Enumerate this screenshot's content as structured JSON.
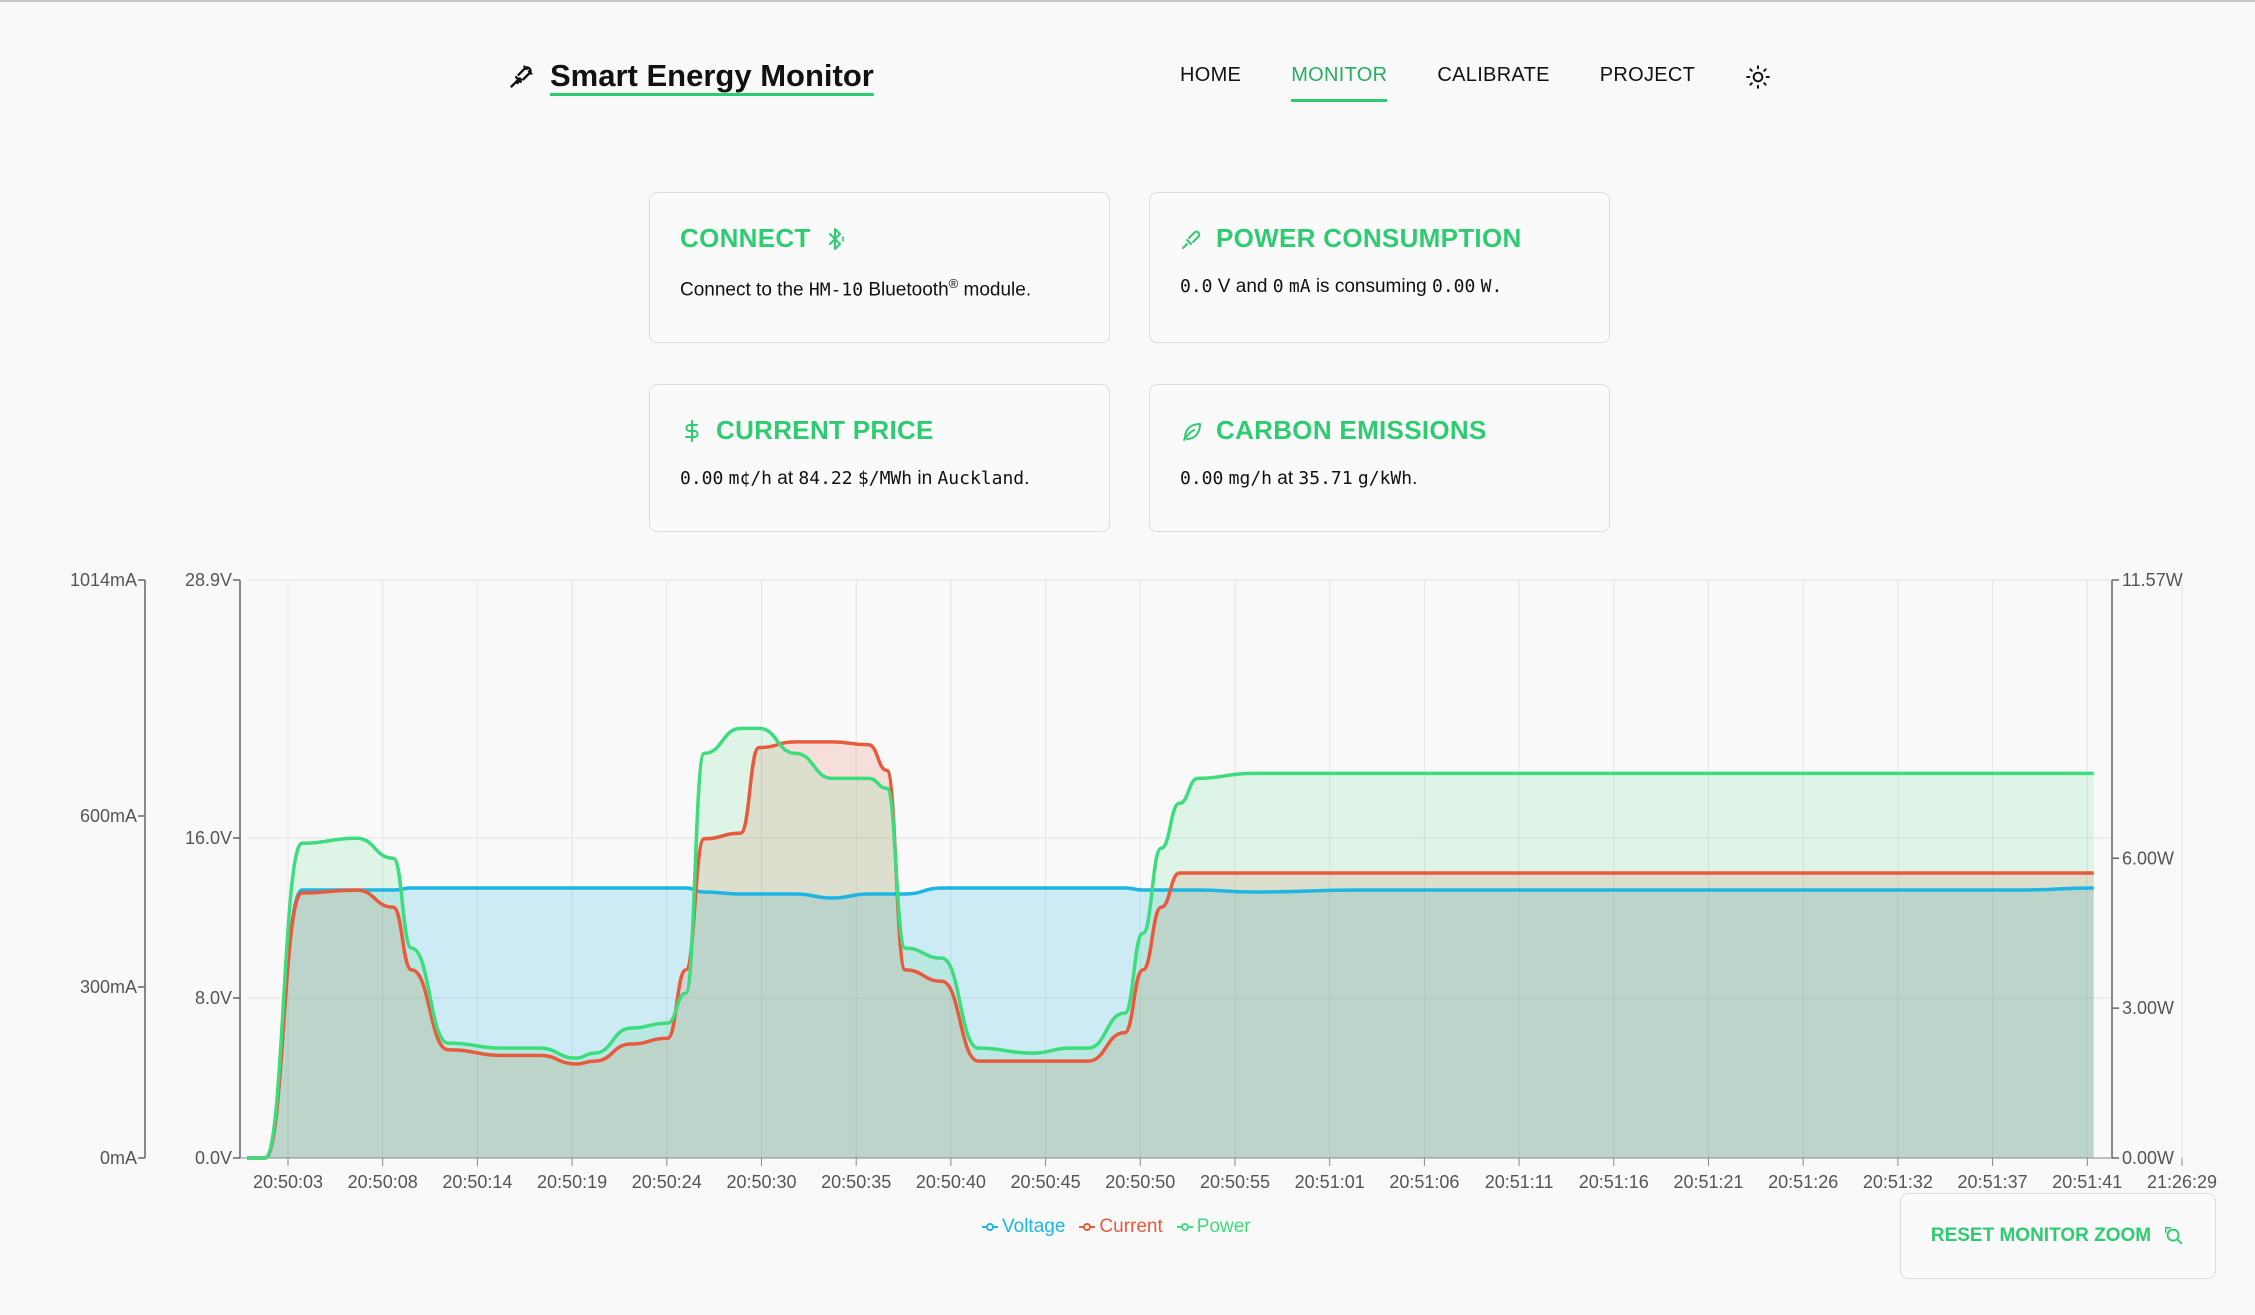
{
  "header": {
    "title": "Smart Energy Monitor",
    "logo_icon": "plug-icon",
    "nav": [
      {
        "label": "HOME",
        "active": false
      },
      {
        "label": "MONITOR",
        "active": true
      },
      {
        "label": "CALIBRATE",
        "active": false
      },
      {
        "label": "PROJECT",
        "active": false
      }
    ],
    "theme_icon": "sun-icon"
  },
  "cards": {
    "connect": {
      "title": "CONNECT",
      "icon": "bluetooth-icon",
      "text_pre": "Connect to the",
      "module": "HM-10",
      "text_mid": "Bluetooth",
      "registered": "®",
      "text_post": "module."
    },
    "power": {
      "title": "POWER CONSUMPTION",
      "icon": "plug-icon",
      "voltage": "0.0",
      "voltage_unit": "V and",
      "current": "0",
      "current_unit": "mA",
      "text_mid": "is consuming",
      "power": "0.00",
      "power_unit": "W."
    },
    "price": {
      "title": "CURRENT PRICE",
      "icon": "dollar-icon",
      "cost": "0.00",
      "cost_unit": "m¢/h",
      "text_at": "at",
      "rate": "84.22",
      "rate_unit": "$/MWh",
      "text_in": "in",
      "region": "Auckland",
      "text_end": "."
    },
    "carbon": {
      "title": "CARBON EMISSIONS",
      "icon": "leaf-icon",
      "emission": "0.00",
      "emission_unit": "mg/h",
      "text_at": "at",
      "intensity": "35.71",
      "intensity_unit": "g/kWh",
      "text_end": "."
    }
  },
  "reset_button": {
    "label": "RESET MONITOR ZOOM",
    "icon": "zoom-reset-icon"
  },
  "colors": {
    "accent": "#2ecc71",
    "voltage": "#1fb5e3",
    "current": "#e85a3c",
    "power": "#3ddc7c"
  },
  "chart_data": {
    "type": "area",
    "x": [
      "20:50:00",
      "20:50:01",
      "20:50:03",
      "20:50:06",
      "20:50:08",
      "20:50:09",
      "20:50:11",
      "20:50:14",
      "20:50:16",
      "20:50:18",
      "20:50:19",
      "20:50:21",
      "20:50:23",
      "20:50:24",
      "20:50:25",
      "20:50:27",
      "20:50:28",
      "20:50:30",
      "20:50:32",
      "20:50:34",
      "20:50:35",
      "20:50:36",
      "20:50:38",
      "20:50:40",
      "20:50:43",
      "20:50:45",
      "20:50:46",
      "20:50:48",
      "20:50:49",
      "20:50:50",
      "20:50:51",
      "20:50:52",
      "20:50:55",
      "20:51:01",
      "20:51:06",
      "20:51:11",
      "20:51:16",
      "20:51:21",
      "20:51:26",
      "20:51:32",
      "20:51:37",
      "20:51:41"
    ],
    "x_tick_labels": [
      "20:50:03",
      "20:50:08",
      "20:50:14",
      "20:50:19",
      "20:50:24",
      "20:50:30",
      "20:50:35",
      "20:50:40",
      "20:50:45",
      "20:50:50",
      "20:50:55",
      "20:51:01",
      "20:51:06",
      "20:51:11",
      "20:51:16",
      "20:51:21",
      "20:51:26",
      "20:51:32",
      "20:51:37",
      "20:51:41",
      "21:26:29"
    ],
    "series": [
      {
        "name": "Voltage",
        "axis": "voltage",
        "values": [
          0,
          0,
          13.4,
          13.4,
          13.4,
          13.5,
          13.5,
          13.5,
          13.5,
          13.5,
          13.5,
          13.5,
          13.5,
          13.5,
          13.3,
          13.2,
          13.2,
          13.2,
          13.0,
          13.2,
          13.2,
          13.2,
          13.5,
          13.5,
          13.5,
          13.5,
          13.5,
          13.5,
          13.4,
          13.4,
          13.4,
          13.4,
          13.3,
          13.4,
          13.4,
          13.4,
          13.4,
          13.4,
          13.4,
          13.4,
          13.4,
          13.5
        ]
      },
      {
        "name": "Current",
        "axis": "current",
        "values": [
          0,
          0,
          465,
          470,
          440,
          330,
          190,
          180,
          180,
          165,
          170,
          200,
          210,
          330,
          560,
          570,
          720,
          730,
          730,
          725,
          680,
          330,
          310,
          170,
          170,
          170,
          170,
          220,
          330,
          440,
          500,
          500,
          500,
          500,
          500,
          500,
          500,
          500,
          500,
          500,
          500,
          500
        ]
      },
      {
        "name": "Power",
        "axis": "power",
        "values": [
          0,
          0,
          6.3,
          6.4,
          6.0,
          4.2,
          2.3,
          2.2,
          2.2,
          2.0,
          2.1,
          2.6,
          2.7,
          3.3,
          8.1,
          8.6,
          8.6,
          8.1,
          7.6,
          7.6,
          7.4,
          4.2,
          4.0,
          2.2,
          2.1,
          2.2,
          2.2,
          2.9,
          4.5,
          6.2,
          7.1,
          7.6,
          7.7,
          7.7,
          7.7,
          7.7,
          7.7,
          7.7,
          7.7,
          7.7,
          7.7,
          7.7
        ]
      }
    ],
    "axes": {
      "current": {
        "ticks": [
          "0mA",
          "300mA",
          "600mA",
          "1014mA"
        ],
        "tick_values": [
          0,
          300,
          600,
          1014
        ],
        "range": [
          0,
          1014
        ]
      },
      "voltage": {
        "ticks": [
          "0.0V",
          "8.0V",
          "16.0V",
          "28.9V"
        ],
        "tick_values": [
          0,
          8,
          16,
          28.9
        ],
        "range": [
          0,
          28.9
        ]
      },
      "power": {
        "ticks": [
          "0.00W",
          "3.00W",
          "6.00W",
          "11.57W"
        ],
        "tick_values": [
          0,
          3,
          6,
          11.57
        ],
        "range": [
          0,
          11.57
        ]
      }
    },
    "grid": true,
    "legend_position": "bottom-center"
  }
}
